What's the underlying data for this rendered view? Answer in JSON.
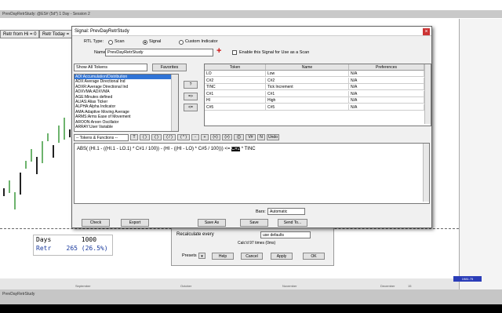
{
  "chart_window": {
    "title": "PrevDayRetrStudy: @ES# (5d*) 1 Day - Session 2",
    "tabs": [
      "Retr from Hi = 0",
      "Retr Today ="
    ],
    "bottom_tab": "PrevDayRetrStudy",
    "info": {
      "days_label": "Days",
      "days_value": "1000",
      "retr_label": "Retr",
      "retr_value": "265 (26.5%)"
    },
    "axis_months": [
      "September",
      "October",
      "November",
      "December"
    ],
    "axis_days": [
      "17",
      "24",
      "3",
      "8",
      "15",
      "22",
      "29",
      "6",
      "13",
      "20",
      "27",
      "3",
      "10",
      "17",
      "24",
      "1",
      "8",
      "15",
      "22",
      "29"
    ],
    "axis_year_label": "15",
    "price_tag": "1981.75"
  },
  "underlying_dialog": {
    "recalculate_label": "Recalculate every",
    "recalculate_value": "use defaults",
    "calc_text": "Calc'd 97 times (0ms)",
    "presets_label": "Presets",
    "buttons": [
      "Help",
      "Cancel",
      "Apply",
      "OK"
    ]
  },
  "dialog": {
    "title": "Signal: PrevDayRetrStudy",
    "close": "×",
    "rtl_type_label": "RTL Type:",
    "rtl_types": [
      "Scan",
      "Signal",
      "Custom Indicator"
    ],
    "rtl_selected": "Signal",
    "name_label": "Name:",
    "name_value": "PrevDayRetrStudy",
    "enable_scan_label": "Enable this Signal for Use as a Scan",
    "show_tokens_value": "Show All Tokens",
    "favorites_label": "Favorites",
    "tokens": [
      "ADI:Accumulation/Distribution",
      "ADX:Average Directional Ind",
      "ADXR:Average Directional Ind",
      "ADXVMA:ADXVMA",
      "AGE:Minutes defined",
      "ALIAS:Alias Ticker",
      "ALPHA:Alpha Indicator",
      "AMA:Adaptive Moving Average",
      "ARMS:Arms Ease of Movement",
      "AROON:Aroon Oscillator",
      "ARRAY:User Variable"
    ],
    "arrow_buttons": [
      "?",
      "=>",
      "<="
    ],
    "grid_headers": [
      "Token",
      "Name",
      "Preferences"
    ],
    "grid_rows": [
      [
        "LO",
        "Low",
        "N/A"
      ],
      [
        "C#2",
        "C#2",
        "N/A"
      ],
      [
        "TINC",
        "Tick Increment",
        "N/A"
      ],
      [
        "C#1",
        "C#1",
        "N/A"
      ],
      [
        "HI",
        "High",
        "N/A"
      ],
      [
        "C#5",
        "C#5",
        "N/A"
      ]
    ],
    "token_functions_label": "-- Tokens & Functions --",
    "token_buttons": [
      "T",
      "( )",
      "( )",
      "( / )",
      "( * )",
      "-",
      "+",
      "(<)",
      "(>)",
      "(|)",
      "V#",
      "N",
      "Undo"
    ],
    "formula_pre": "ABS(  (HI.1 - ((HI.1 - LO.1) * C#1 / 100)) - (HI - ((HI - LO) * C#5 / 100)))  <=  ",
    "formula_highlight": "C#2",
    "formula_post": " * TINC",
    "bars_label": "Bars:",
    "bars_value": "Automatic",
    "bottom_buttons": [
      "Check",
      "Export",
      "Save As",
      "Save",
      "Send To..."
    ]
  },
  "colors": {
    "selection": "#3074d6",
    "add_icon": "#cc1111",
    "close_button": "#cc3333"
  }
}
